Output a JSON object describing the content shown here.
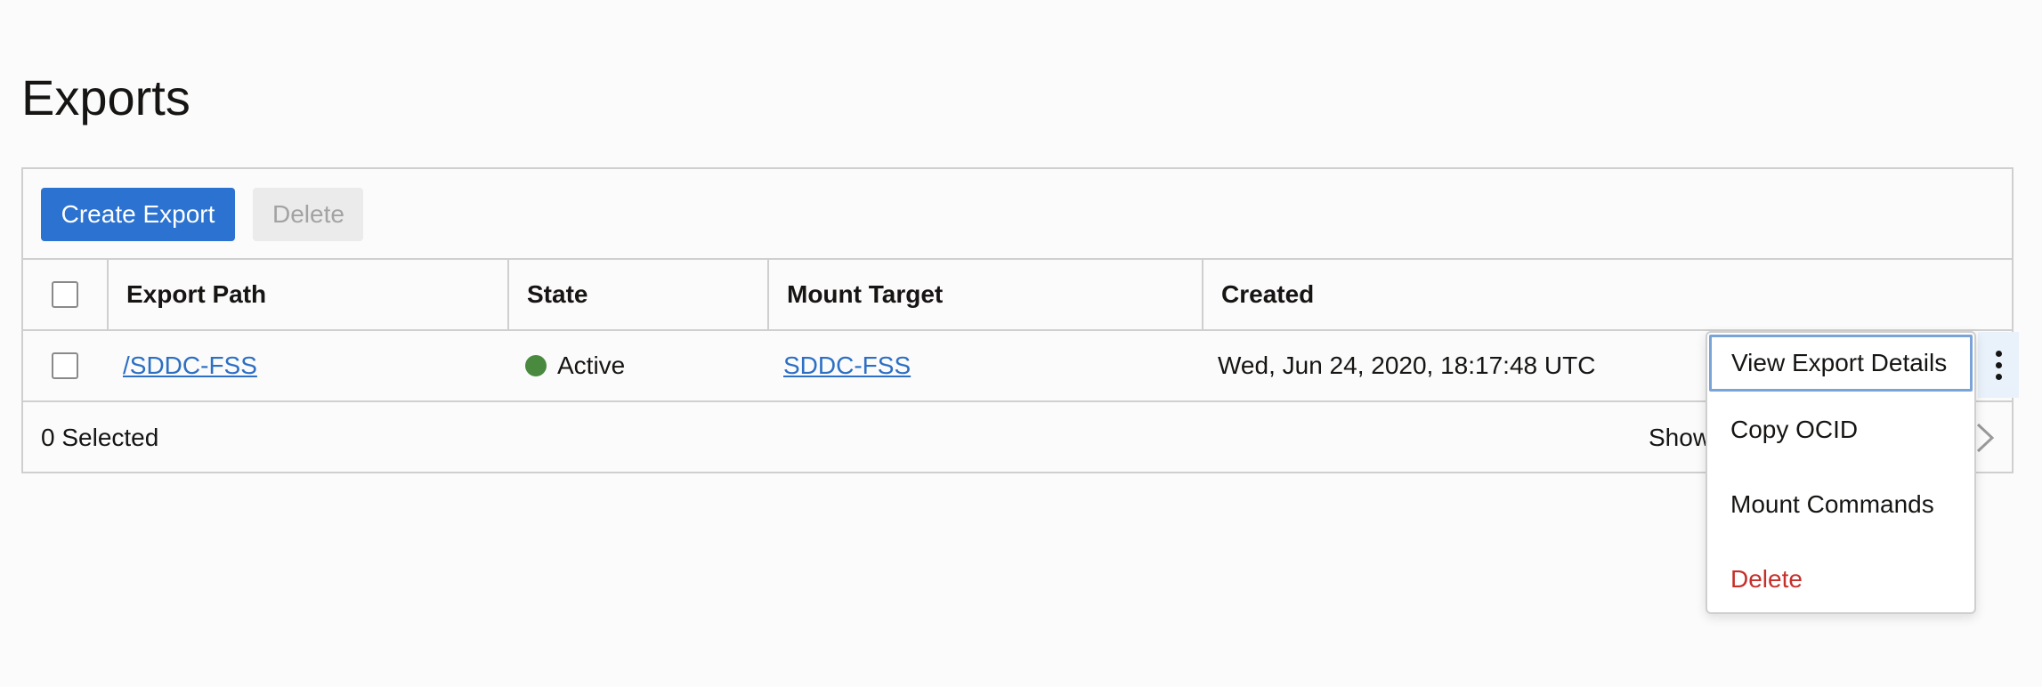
{
  "page": {
    "title": "Exports"
  },
  "toolbar": {
    "create_label": "Create Export",
    "delete_label": "Delete"
  },
  "table": {
    "headers": {
      "export_path": "Export Path",
      "state": "State",
      "mount_target": "Mount Target",
      "created": "Created"
    },
    "rows": [
      {
        "export_path": "/SDDC-FSS",
        "state": "Active",
        "state_color": "#4a8a3f",
        "mount_target": "SDDC-FSS",
        "created": "Wed, Jun 24, 2020, 18:17:48 UTC"
      }
    ]
  },
  "footer": {
    "selected": "0 Selected",
    "showing_partial": "Show"
  },
  "actions_menu": {
    "items": [
      {
        "label": "View Export Details"
      },
      {
        "label": "Copy OCID"
      },
      {
        "label": "Mount Commands"
      },
      {
        "label": "Delete",
        "danger_color": "#c5302c"
      }
    ]
  },
  "icons": {
    "kebab": "vertical-ellipsis-icon",
    "pager_next": "chevron-right-icon"
  },
  "colors": {
    "primary": "#2c72d0",
    "link": "#2c6fc4",
    "focus_outline": "#7aa3d8"
  }
}
